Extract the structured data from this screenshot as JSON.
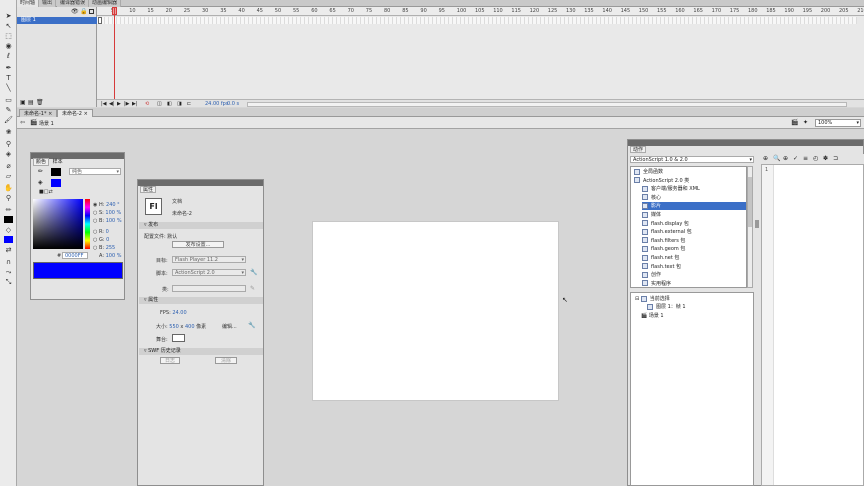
{
  "top_tabs": [
    "时间轴",
    "输出",
    "编译器错误",
    "动画编辑器"
  ],
  "timeline": {
    "layer_name": "图层 1",
    "frame_ticks": [
      "5",
      "10",
      "15",
      "20",
      "25",
      "30",
      "35",
      "40",
      "45",
      "50",
      "55",
      "60",
      "65",
      "70",
      "75",
      "80",
      "85",
      "90",
      "95",
      "100",
      "105",
      "110",
      "115",
      "120",
      "125",
      "130",
      "135",
      "140",
      "145",
      "150",
      "155",
      "160",
      "165",
      "170",
      "175",
      "180",
      "185",
      "190",
      "195",
      "200",
      "205",
      "210"
    ],
    "fps_readout": "24.00 fps",
    "time_readout": "0.0 s"
  },
  "doc_tabs": [
    "未命名-1*",
    "未命名-2"
  ],
  "editbar": {
    "scene_label": "场景 1",
    "zoom_value": "100%"
  },
  "color_panel": {
    "tabs": [
      "颜色",
      "样本"
    ],
    "type_value": "纯色",
    "hsb": [
      {
        "label": "H:",
        "value": "240 °"
      },
      {
        "label": "S:",
        "value": "100 %"
      },
      {
        "label": "B:",
        "value": "100 %"
      }
    ],
    "rgb": [
      {
        "label": "R:",
        "value": "0"
      },
      {
        "label": "G:",
        "value": "0"
      },
      {
        "label": "B:",
        "value": "255"
      }
    ],
    "alpha": {
      "label": "A:",
      "value": "100 %"
    },
    "hex_label": "#",
    "hex_value": "0000FF",
    "colors": {
      "fill": "#0000ff",
      "stroke": "#000000"
    }
  },
  "properties": {
    "tab": "属性",
    "doc_type": "文档",
    "doc_icon": "Fl",
    "doc_name": "未命名-2",
    "publish_section": "发布",
    "profile_label": "配置文件:",
    "profile_value": "默认",
    "publish_settings_button": "发布设置...",
    "target_label": "目标:",
    "target_value": "Flash Player 11.2",
    "script_label": "脚本:",
    "script_value": "ActionScript 2.0",
    "class_label": "类:",
    "props_section": "属性",
    "fps_label": "FPS:",
    "fps_value": "24.00",
    "size_label": "大小:",
    "width_value": "550",
    "x_sep": "x",
    "height_value": "400",
    "px_unit": "像素",
    "edit_button": "编辑...",
    "stage_label": "舞台:",
    "swf_section": "SWF 历史记录",
    "log_button": "日志",
    "clear_button": "清除"
  },
  "actions_panel": {
    "tab": "动作",
    "version_value": "ActionScript 1.0 & 2.0",
    "tree": [
      "全局函数",
      "ActionScript 2.0 类",
      "客户端/服务器和 XML",
      "核心",
      "影片",
      "媒体",
      "flash.display 包",
      "flash.external 包",
      "flash.filters 包",
      "flash.geom 包",
      "flash.net 包",
      "flash.text 包",
      "创作",
      "实用程序"
    ],
    "selected_index": 4,
    "lower_tree": [
      "当前选择",
      "图层 1：帧 1",
      "场景 1"
    ],
    "line_number": "1"
  }
}
